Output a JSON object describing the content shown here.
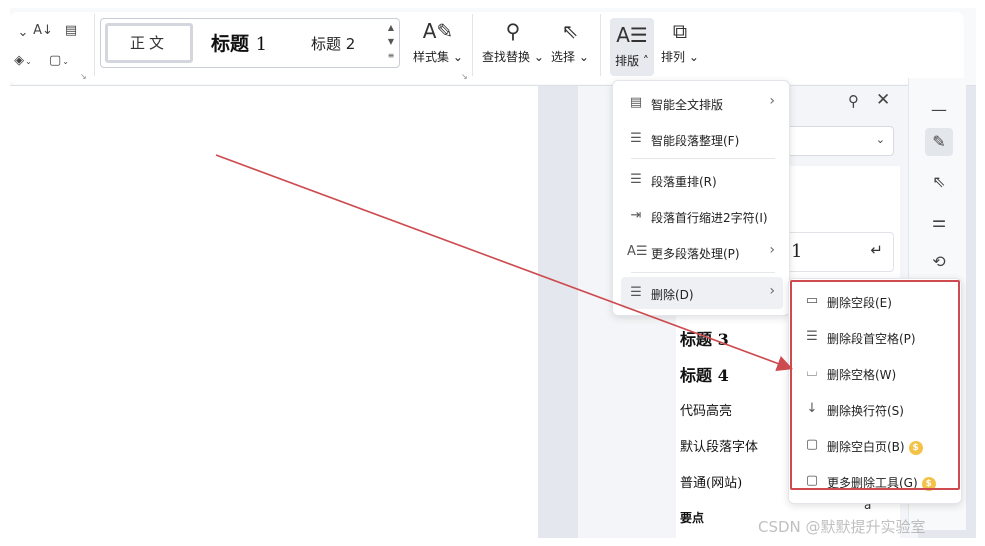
{
  "ribbon": {
    "style_gallery": {
      "zhengwen": "正文",
      "heading1_text": "标题",
      "heading1_num": "1",
      "heading2": "标题 2"
    },
    "buttons": {
      "style_set": "样式集",
      "find_replace": "查找替换",
      "select": "选择",
      "typeset": "排版",
      "arrange": "排列"
    }
  },
  "typeset_menu": {
    "items": [
      {
        "label": "智能全文排版"
      },
      {
        "label": "智能段落整理(F)"
      },
      {
        "label": "段落重排(R)"
      },
      {
        "label": "段落首行缩进2字符(I)"
      },
      {
        "label": "更多段落处理(P)"
      },
      {
        "label": "删除(D)"
      }
    ]
  },
  "delete_submenu": {
    "items": [
      {
        "label": "删除空段(E)"
      },
      {
        "label": "删除段首空格(P)"
      },
      {
        "label": "删除空格(W)"
      },
      {
        "label": "删除换行符(S)"
      },
      {
        "label": "删除空白页(B)"
      },
      {
        "label": "更多删除工具(G)"
      }
    ]
  },
  "styles_panel": {
    "card_num": "1",
    "styles": [
      "标题 3",
      "标题 4",
      "代码高亮",
      "默认段落字体",
      "普通(网站)",
      "要点"
    ],
    "trailing_glyph": "a"
  },
  "watermark": "CSDN @默默提升实验室",
  "colors": {
    "arrow": "#cd4a4f",
    "outline": "#cd4a4f",
    "vip_badge": "#f4c247"
  }
}
